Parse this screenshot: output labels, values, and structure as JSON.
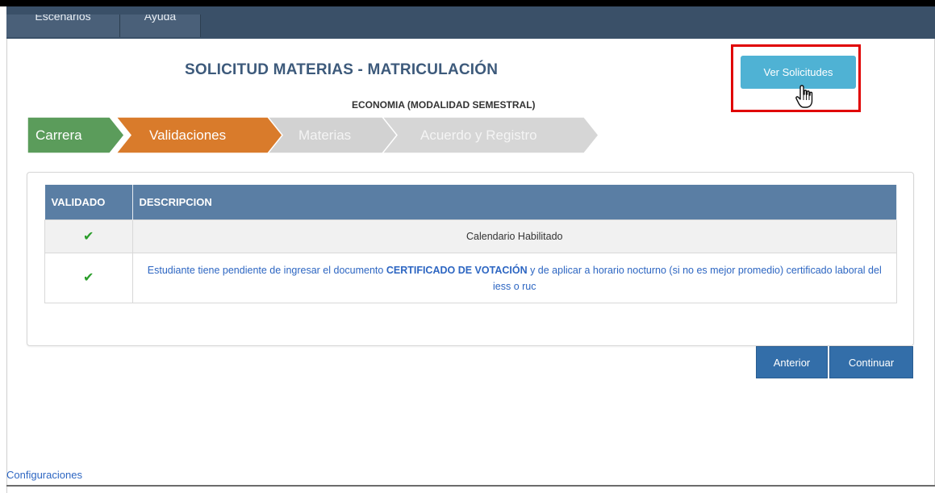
{
  "nav": {
    "tabs": [
      "Escenarios",
      "Ayuda"
    ]
  },
  "header": {
    "title": "SOLICITUD MATERIAS - MATRICULACIÓN",
    "subtitle": "ECONOMIA (MODALIDAD SEMESTRAL)",
    "ver_solicitudes_label": "Ver Solicitudes"
  },
  "stepper": {
    "steps": [
      {
        "label": "Carrera",
        "status": "completed"
      },
      {
        "label": "Validaciones",
        "status": "active"
      },
      {
        "label": "Materias",
        "status": "pending"
      },
      {
        "label": "Acuerdo y Registro",
        "status": "pending"
      }
    ]
  },
  "validation_table": {
    "headers": [
      "VALIDADO",
      "DESCRIPCION"
    ],
    "rows": [
      {
        "validado": "✔",
        "descripcion": "Calendario Habilitado"
      },
      {
        "validado": "✔",
        "descripcion_before": "Estudiante tiene pendiente de ingresar el documento ",
        "descripcion_bold": "CERTIFICADO DE VOTACIÓN",
        "descripcion_after": " y de aplicar a horario nocturno (si no es mejor promedio) certificado laboral del iess o ruc"
      }
    ]
  },
  "actions": {
    "anterior_label": "Anterior",
    "continuar_label": "Continuar"
  },
  "footer": {
    "config_link": "Configuraciones"
  },
  "colors": {
    "navbar": "#3a5068",
    "step_completed": "#5b9c5b",
    "step_active": "#d97b2b",
    "step_pending": "#cfcfcf",
    "table_header": "#5a7ea4",
    "button_primary": "#336ea9",
    "button_info": "#4fb2d4",
    "highlight": "#e00000"
  },
  "icons": [
    "check-icon",
    "hand-cursor-icon"
  ]
}
